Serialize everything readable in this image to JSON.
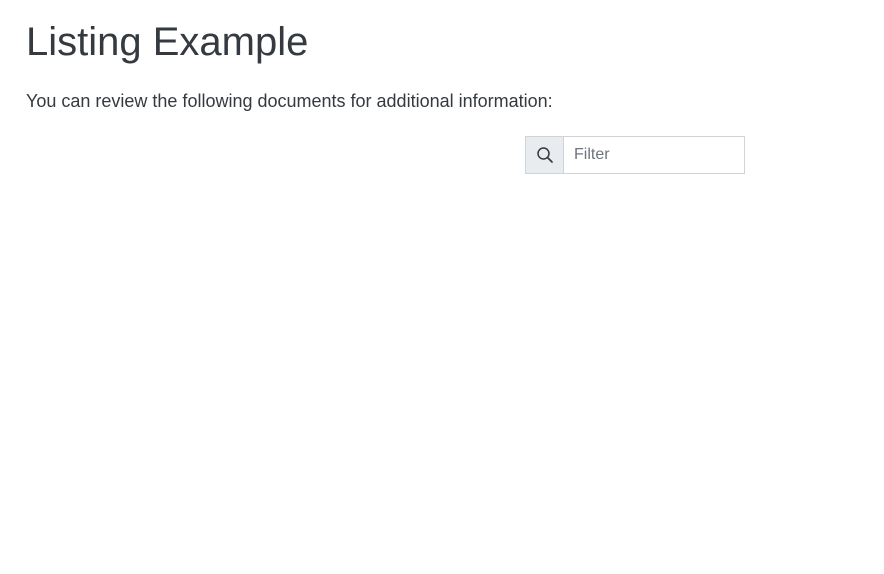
{
  "page": {
    "title": "Listing Example",
    "intro": "You can review the following documents for additional information:"
  },
  "filter": {
    "icon": "search-icon",
    "placeholder": "Filter",
    "value": ""
  }
}
